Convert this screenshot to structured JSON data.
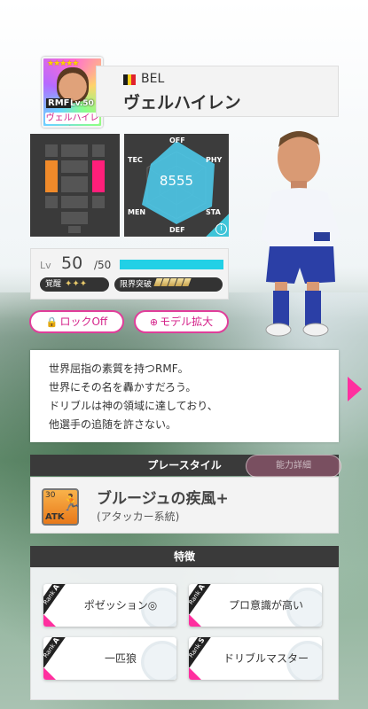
{
  "card": {
    "stars": "★★★★★",
    "position": "RMF",
    "level": "Lv.50",
    "name": "ヴェルハイレン"
  },
  "player": {
    "nation": "BEL",
    "name": "ヴェルハイレン",
    "flag_colors": [
      "#1b1b1b",
      "#f7d11b",
      "#e0222d"
    ]
  },
  "radar": {
    "overall": "8555",
    "labels": [
      "OFF",
      "TEC",
      "PHY",
      "MEN",
      "STA",
      "DEF"
    ],
    "info": "i"
  },
  "level": {
    "label": "Lv",
    "value": "50",
    "max": "/50",
    "progress": 1.0,
    "awaken_label": "覚醒",
    "awaken_stars": "✦✦✦",
    "limit_break_label": "限界突破"
  },
  "buttons": {
    "lock": "ロックOff",
    "lock_icon": "🔒",
    "model": "モデル拡大",
    "model_icon": "⊕"
  },
  "description": [
    "世界屈指の素質を持つRMF。",
    "世界にその名を轟かすだろう。",
    "ドリブルは神の領域に達しており、",
    "他選手の追随を許さない。"
  ],
  "play_style": {
    "header": "プレースタイル",
    "ability_button": "能力詳細",
    "icon_number": "30",
    "icon_label": "ATK",
    "name": "ブルージュの疾風+",
    "subtitle": "(アタッカー系統)"
  },
  "traits": {
    "header": "特徴",
    "items": [
      {
        "rank": "A",
        "label": "ポゼッション◎"
      },
      {
        "rank": "A",
        "label": "プロ意識が高い"
      },
      {
        "rank": "A",
        "label": "一匹狼"
      },
      {
        "rank": "S",
        "label": "ドリブルマスター"
      }
    ]
  },
  "colors": {
    "accent_pink": "#e03e9a",
    "bar_cyan": "#22d0e6",
    "panel_dark": "#3a3a3a"
  }
}
